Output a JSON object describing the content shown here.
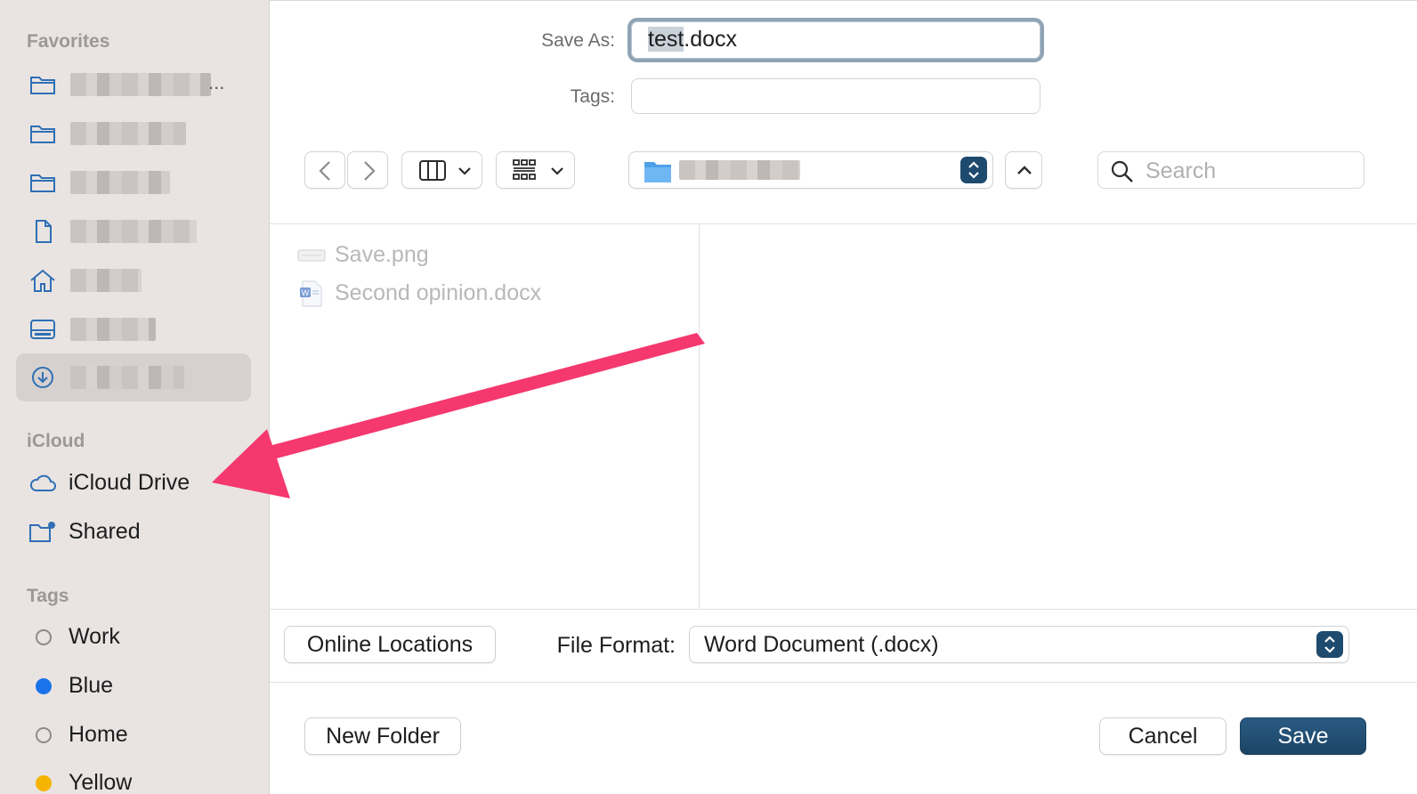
{
  "sidebar": {
    "favorites_heading": "Favorites",
    "favorites": [
      {
        "icon": "folder-icon",
        "label_redacted": true
      },
      {
        "icon": "folder-icon",
        "label_redacted": true
      },
      {
        "icon": "folder-icon",
        "label_redacted": true
      },
      {
        "icon": "document-icon",
        "label_redacted": true
      },
      {
        "icon": "home-icon",
        "label_redacted": true
      },
      {
        "icon": "drive-icon",
        "label_redacted": true
      },
      {
        "icon": "download-icon",
        "label_redacted": true,
        "selected": true
      }
    ],
    "first_item_ellipsis": "...",
    "icloud_heading": "iCloud",
    "icloud_items": [
      {
        "icon": "cloud-icon",
        "label": "iCloud Drive"
      },
      {
        "icon": "shared-folder-icon",
        "label": "Shared"
      }
    ],
    "tags_heading": "Tags",
    "tags": [
      {
        "label": "Work",
        "color": "",
        "hollow": true
      },
      {
        "label": "Blue",
        "color": "#1a73e8",
        "hollow": false
      },
      {
        "label": "Home",
        "color": "",
        "hollow": true
      },
      {
        "label": "Yellow",
        "color": "#f5b400",
        "hollow": false
      }
    ]
  },
  "dialog": {
    "save_as_label": "Save As:",
    "filename_selected": "test",
    "filename_ext": ".docx",
    "tags_label": "Tags:",
    "tags_value": "",
    "search_placeholder": "Search",
    "location_redacted": true,
    "files": [
      {
        "name": "Save.png",
        "icon": "image-file-icon"
      },
      {
        "name": "Second opinion.docx",
        "icon": "word-file-icon"
      }
    ],
    "online_locations_label": "Online Locations",
    "file_format_label": "File Format:",
    "file_format_value": "Word Document (.docx)",
    "new_folder_label": "New Folder",
    "cancel_label": "Cancel",
    "save_label": "Save"
  },
  "colors": {
    "accent": "#1e4a6e",
    "annotation_arrow": "#f5386e",
    "sidebar_bg": "#e9e4e2"
  }
}
